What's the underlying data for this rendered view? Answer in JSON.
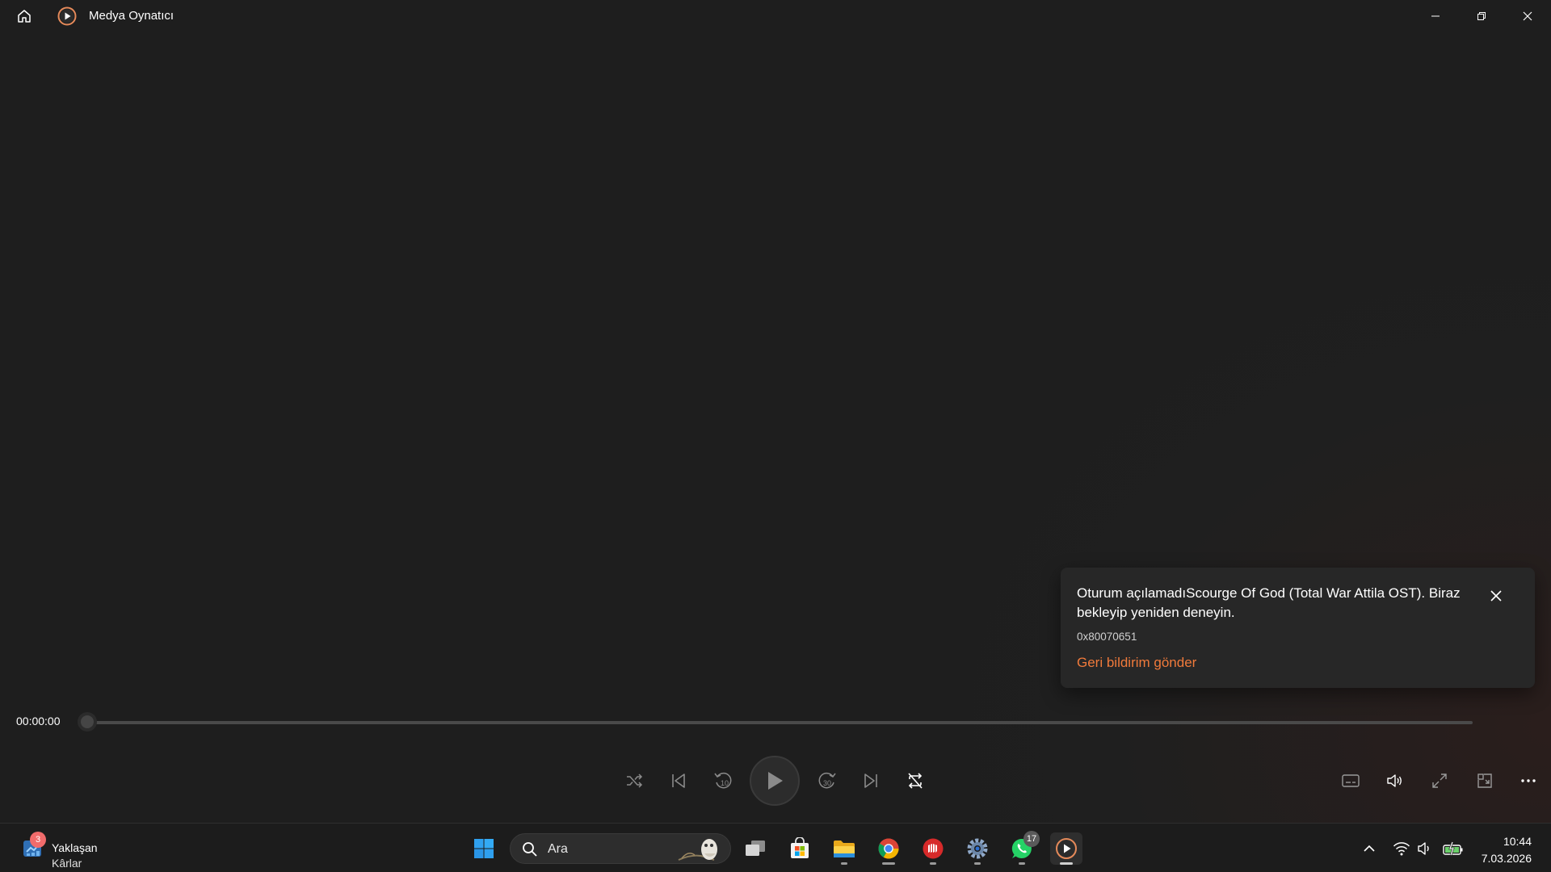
{
  "app": {
    "title": "Medya Oynatıcı",
    "icons": {
      "home": "home-icon",
      "logo": "media-player-logo-icon"
    },
    "window_controls": [
      "minimize-icon",
      "restore-icon",
      "close-icon"
    ]
  },
  "toast": {
    "message": "Oturum açılamadıScourge Of God (Total War Attila OST). Biraz bekleyip yeniden deneyin.",
    "code": "0x80070651",
    "link": "Geri bildirim gönder",
    "link_color": "#f07a3b"
  },
  "player": {
    "current_time": "00:00:00",
    "progress": 0,
    "controls": [
      "shuffle-icon",
      "previous-icon",
      "rewind-10-icon",
      "play-icon",
      "forward-30-icon",
      "next-icon",
      "repeat-off-icon"
    ],
    "right_controls": [
      "subtitles-icon",
      "volume-icon",
      "fullscreen-icon",
      "mini-player-icon",
      "more-icon"
    ]
  },
  "taskbar": {
    "weather": {
      "badge": "3",
      "line1": "Yaklaşan",
      "line2": "Kârlar"
    },
    "search_placeholder": "Ara",
    "apps": [
      "start-icon",
      "task-view-icon",
      "microsoft-store-icon",
      "file-explorer-icon",
      "chrome-icon",
      "red-app-icon",
      "settings-icon",
      "whatsapp-icon",
      "media-player-icon"
    ],
    "whatsapp_badge": "17",
    "tray": [
      "chevron-up-icon",
      "wifi-icon",
      "speaker-icon",
      "battery-icon"
    ],
    "time": "10:44",
    "date": "7.03.2026"
  }
}
